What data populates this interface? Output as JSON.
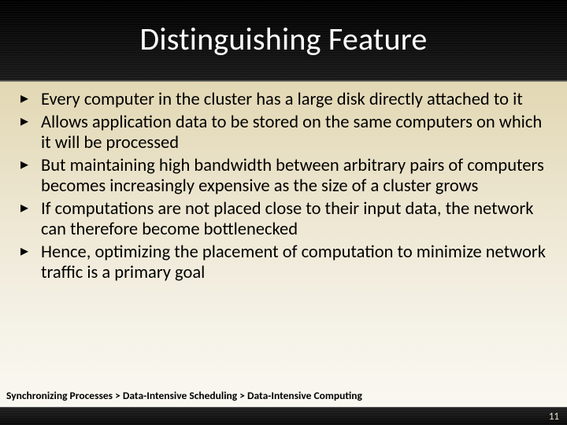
{
  "title": "Distinguishing Feature",
  "bullets": [
    "Every computer in the cluster has a large disk directly attached to it",
    "Allows application data to be stored on the same computers on which it will be processed",
    "But maintaining high bandwidth between arbitrary pairs of computers becomes increasingly expensive as the size of a cluster grows",
    "If computations are not placed close to their input data, the network can therefore become bottlenecked",
    "Hence, optimizing the placement of computation to minimize network traffic is a primary goal"
  ],
  "breadcrumb": "Synchronizing Processes > Data-Intensive Scheduling > Data-Intensive Computing",
  "page_number": "11"
}
